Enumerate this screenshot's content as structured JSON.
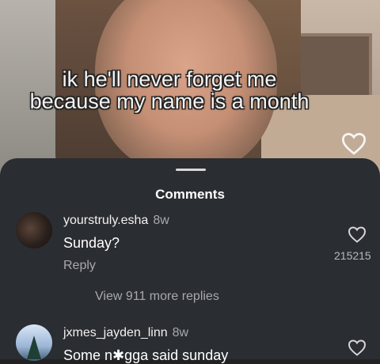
{
  "video": {
    "caption": "ik he'll never forget me because my name is a month"
  },
  "comments_sheet": {
    "title": "Comments",
    "comments": [
      {
        "username": "yourstruly.esha",
        "time": "8w",
        "text": "Sunday?",
        "reply_label": "Reply",
        "view_replies_label": "View 911 more replies",
        "like_count": "215215"
      },
      {
        "username": "jxmes_jayden_linn",
        "time": "8w",
        "text": "Some n✱gga said sunday"
      }
    ]
  },
  "icons": {
    "like": "heart-outline-icon"
  },
  "colors": {
    "sheet_background": "#2a2d31",
    "text_primary": "#ffffff",
    "text_secondary": "#a7a9ad"
  }
}
